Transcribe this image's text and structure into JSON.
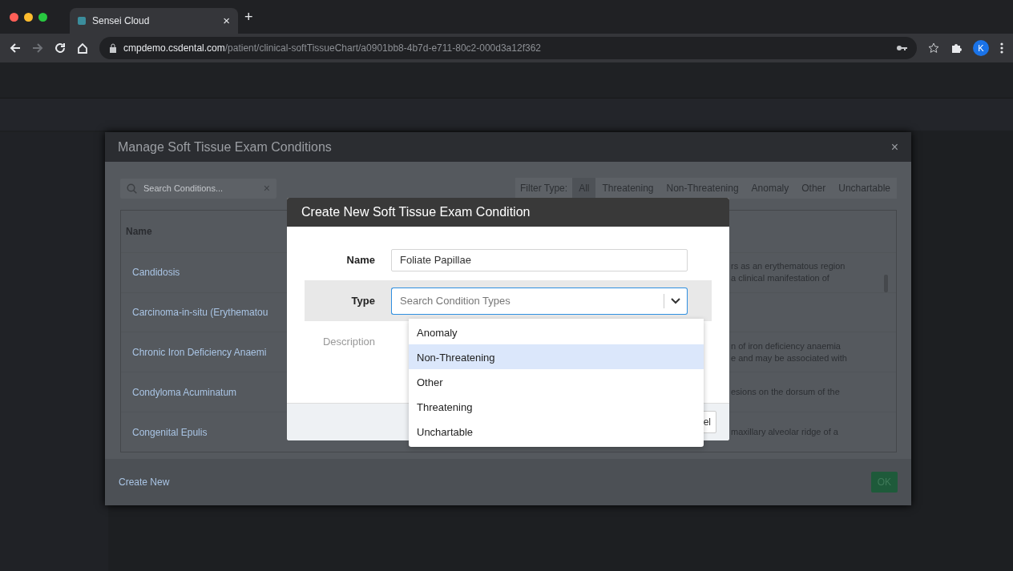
{
  "browser": {
    "tab_title": "Sensei Cloud",
    "tab_close": "×",
    "new_tab": "+",
    "url_host": "cmpdemo.csdental.com",
    "url_path": "/patient/clinical-softTissueChart/a0901bb8-4b7d-e711-80c2-000d3a12f362",
    "profile_initial": "K"
  },
  "manage_dialog": {
    "title": "Manage Soft Tissue Exam Conditions",
    "close": "×",
    "search": {
      "placeholder": "Search Conditions...",
      "clear": "×"
    },
    "filter_label": "Filter Type:",
    "filters": [
      {
        "label": "All",
        "selected": true
      },
      {
        "label": "Threatening",
        "selected": false
      },
      {
        "label": "Non-Threatening",
        "selected": false
      },
      {
        "label": "Anomaly",
        "selected": false
      },
      {
        "label": "Other",
        "selected": false
      },
      {
        "label": "Unchartable",
        "selected": false
      }
    ],
    "table": {
      "columns": [
        "Name"
      ],
      "rows": [
        {
          "name": "Candidosis",
          "description": [
            "rs as an erythematous region",
            "a clinical manifestation of"
          ]
        },
        {
          "name": "Carcinoma-in-situ (Erythematou",
          "description": []
        },
        {
          "name": "Chronic Iron Deficiency Anaemi",
          "description": [
            "n of iron deficiency anaemia",
            "e and may be associated with"
          ]
        },
        {
          "name": "Condyloma Acuminatum",
          "description": [
            "esions on the dorsum of the"
          ]
        },
        {
          "name": "Congenital Epulis",
          "description": [
            "maxillary alveolar ridge of a"
          ]
        }
      ]
    },
    "create_new": "Create New",
    "ok": "OK"
  },
  "create_dialog": {
    "title": "Create New Soft Tissue Exam Condition",
    "name_label": "Name",
    "name_value": "Foliate Papillae",
    "type_label": "Type",
    "type_placeholder": "Search Condition Types",
    "description_label": "Description",
    "cancel_visible": "el",
    "options": [
      {
        "label": "Anomaly",
        "selected": false
      },
      {
        "label": "Non-Threatening",
        "selected": true
      },
      {
        "label": "Other",
        "selected": false
      },
      {
        "label": "Threatening",
        "selected": false
      },
      {
        "label": "Unchartable",
        "selected": false
      }
    ]
  }
}
